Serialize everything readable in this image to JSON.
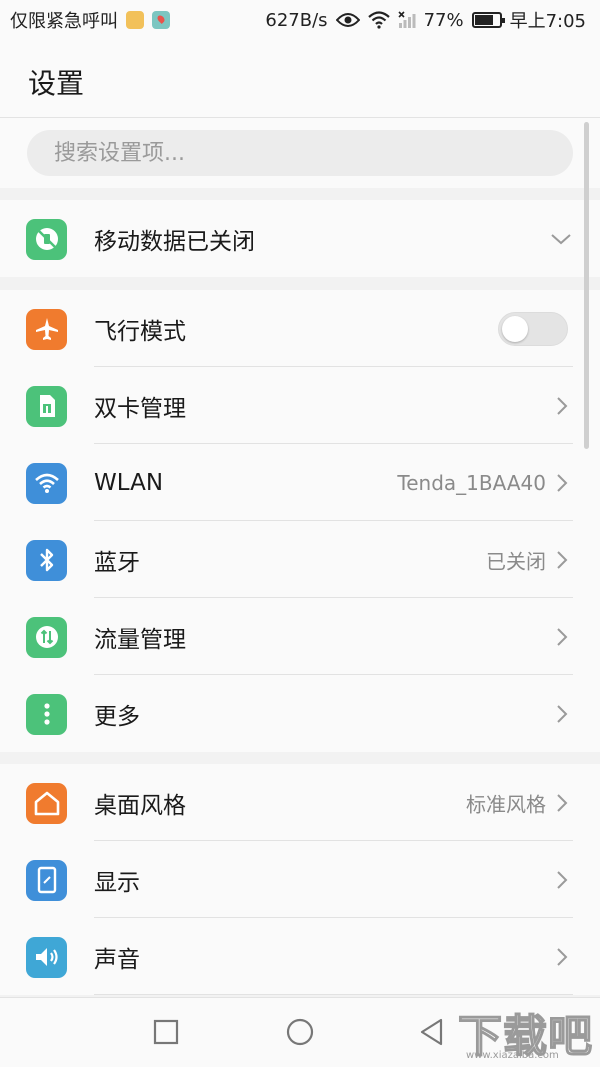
{
  "status_bar": {
    "carrier": "仅限紧急呼叫",
    "net_speed": "627B/s",
    "battery_percent": "77%",
    "battery_level": 0.77,
    "time": "早上7:05"
  },
  "header": {
    "title": "设置"
  },
  "search": {
    "placeholder": "搜索设置项..."
  },
  "mobile_data": {
    "label": "移动数据已关闭",
    "icon": "mobile-data-off-icon",
    "color": "#4cc27a"
  },
  "sections": [
    {
      "items": [
        {
          "label": "飞行模式",
          "icon": "airplane-icon",
          "color": "#f07b2e",
          "toggle": false
        },
        {
          "label": "双卡管理",
          "icon": "sim-card-icon",
          "color": "#4cc27a"
        },
        {
          "label": "WLAN",
          "icon": "wifi-icon",
          "color": "#3f8fd9",
          "value": "Tenda_1BAA40"
        },
        {
          "label": "蓝牙",
          "icon": "bluetooth-icon",
          "color": "#3f8fd9",
          "value": "已关闭"
        },
        {
          "label": "流量管理",
          "icon": "data-usage-icon",
          "color": "#4cc27a"
        },
        {
          "label": "更多",
          "icon": "more-icon",
          "color": "#4cc27a"
        }
      ]
    },
    {
      "items": [
        {
          "label": "桌面风格",
          "icon": "home-style-icon",
          "color": "#f07b2e",
          "value": "标准风格"
        },
        {
          "label": "显示",
          "icon": "display-icon",
          "color": "#3f8fd9"
        },
        {
          "label": "声音",
          "icon": "sound-icon",
          "color": "#3fa7d6"
        }
      ]
    }
  ],
  "watermark": {
    "text": "下载吧",
    "url": "www.xiazaiba.com"
  }
}
